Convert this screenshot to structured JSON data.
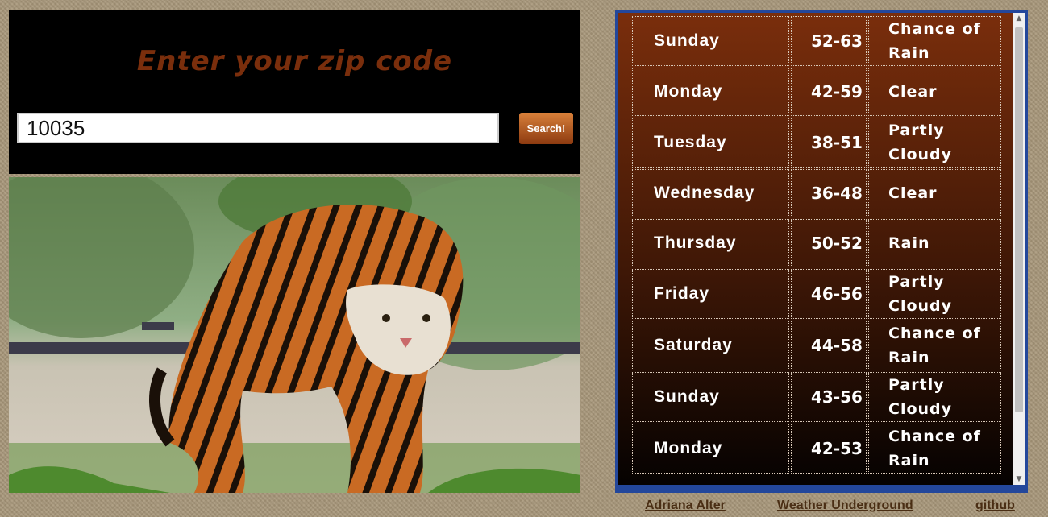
{
  "search": {
    "title": "Enter your zip code",
    "zip_value": "10035",
    "button_label": "Search!"
  },
  "forecast": [
    {
      "day": "Sunday",
      "temp": "52-63",
      "condition": "Chance of Rain"
    },
    {
      "day": "Monday",
      "temp": "42-59",
      "condition": "Clear"
    },
    {
      "day": "Tuesday",
      "temp": "38-51",
      "condition": "Partly Cloudy"
    },
    {
      "day": "Wednesday",
      "temp": "36-48",
      "condition": "Clear"
    },
    {
      "day": "Thursday",
      "temp": "50-52",
      "condition": "Rain"
    },
    {
      "day": "Friday",
      "temp": "46-56",
      "condition": "Partly Cloudy"
    },
    {
      "day": "Saturday",
      "temp": "44-58",
      "condition": "Chance of Rain"
    },
    {
      "day": "Sunday",
      "temp": "43-56",
      "condition": "Partly Cloudy"
    },
    {
      "day": "Monday",
      "temp": "42-53",
      "condition": "Chance of Rain"
    }
  ],
  "footer": {
    "author": "Adriana Alter",
    "source": "Weather Underground",
    "repo": "github"
  },
  "colors": {
    "title": "#7a2e0c",
    "panel_border": "#23479b",
    "link": "#4a2e14"
  }
}
